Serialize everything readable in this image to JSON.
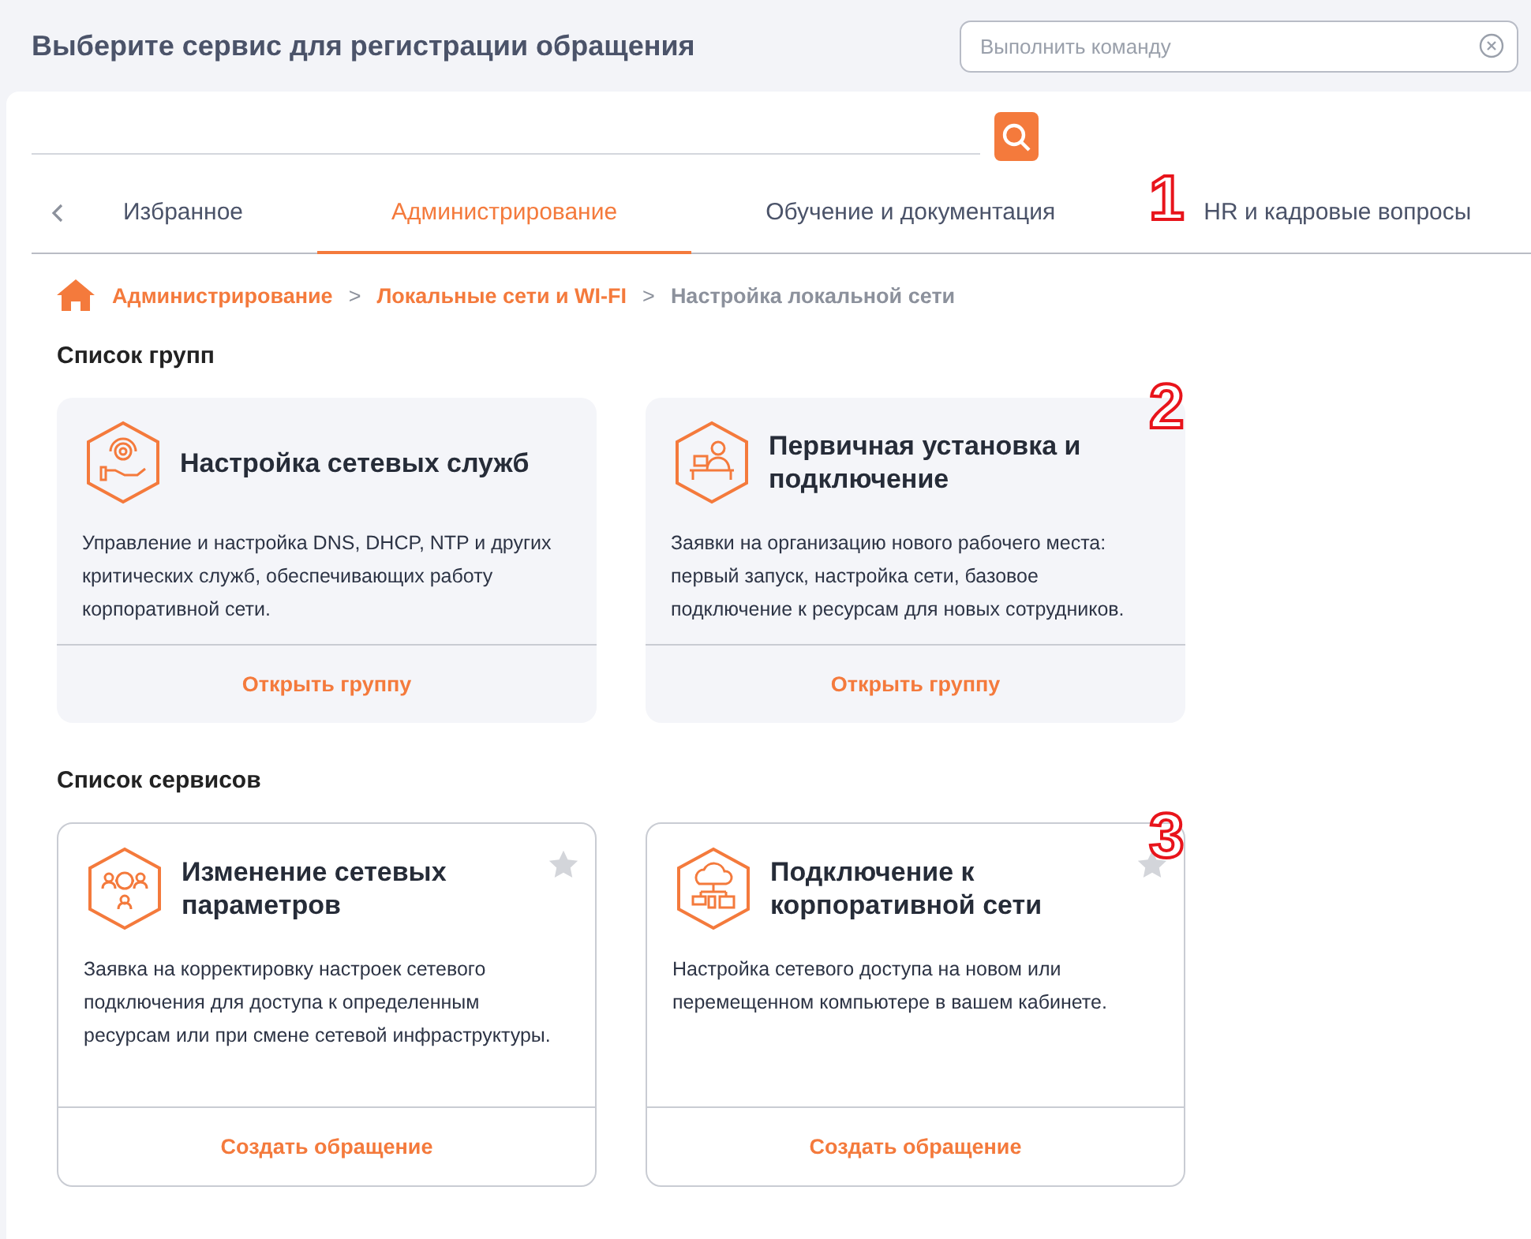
{
  "header": {
    "title": "Выберите сервис для регистрации обращения",
    "command": {
      "placeholder": "Выполнить команду"
    }
  },
  "tabs": [
    {
      "label": "Избранное",
      "selected": false
    },
    {
      "label": "Администрирование",
      "selected": true
    },
    {
      "label": "Обучение и документация",
      "selected": false
    },
    {
      "label": "HR и кадровые вопросы",
      "selected": false
    }
  ],
  "breadcrumbs": [
    {
      "label": "Администрирование",
      "link": true
    },
    {
      "label": ">",
      "link": false
    },
    {
      "label": "Локальные сети и WI-FI",
      "link": true
    },
    {
      "label": ">",
      "link": false
    },
    {
      "label": "Настройка локальной сети",
      "link": false
    }
  ],
  "groups": {
    "heading": "Список групп",
    "items": [
      {
        "title": "Настройка сетевых служб",
        "description": "Управление и настройка DNS, DHCP, NTP и других критических служб, обеспечивающих работу корпоративной сети.",
        "action": "Открыть группу"
      },
      {
        "title": "Первичная установка и подключение",
        "description": "Заявки на организацию нового рабочего места: первый запуск, настройка сети, базовое подключение к ресурсам для новых сотрудников.",
        "action": "Открыть группу"
      }
    ]
  },
  "services": {
    "heading": "Список сервисов",
    "items": [
      {
        "title": "Изменение сетевых параметров",
        "description": "Заявка на корректировку настроек сетевого подключения для доступа к определенным ресурсам или при смене сетевой инфраструктуры.",
        "action": "Создать обращение",
        "favorite": false
      },
      {
        "title": "Подключение к корпоративной сети",
        "description": "Настройка сетевого доступа на новом или перемещенном компьютере в вашем кабинете.",
        "action": "Создать обращение",
        "favorite": false
      }
    ]
  },
  "markers": [
    "1",
    "2",
    "3"
  ]
}
